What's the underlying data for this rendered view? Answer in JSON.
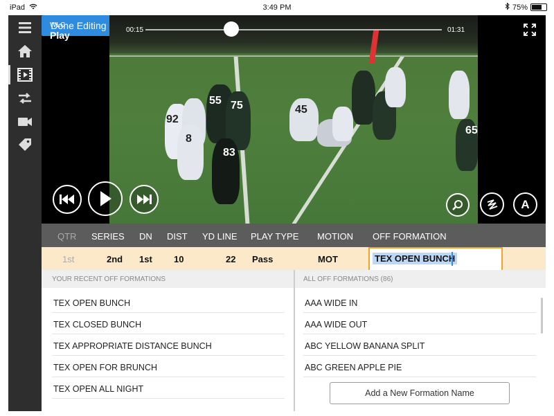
{
  "status_bar": {
    "device": "iPad",
    "time": "3:49 PM",
    "battery": "75%",
    "battery_level": 0.75
  },
  "sidebar": {
    "items": [
      {
        "icon": "menu-icon"
      },
      {
        "icon": "home-icon"
      },
      {
        "icon": "film-icon",
        "active": true
      },
      {
        "icon": "swap-icon"
      },
      {
        "icon": "video-camera-icon"
      },
      {
        "icon": "tag-icon"
      }
    ]
  },
  "video": {
    "team": "WLC",
    "title": "Play",
    "elapsed": "00:15",
    "duration": "01:31",
    "progress": 0.29,
    "done_button": "Done Editing",
    "annotate_label": "A",
    "jersey_numbers": [
      "55",
      "75",
      "92",
      "8",
      "83",
      "45",
      "65"
    ]
  },
  "table": {
    "headers": [
      "QTR",
      "SERIES",
      "DN",
      "DIST",
      "YD LINE",
      "PLAY TYPE",
      "MOTION",
      "OFF FORMATION"
    ],
    "row": [
      "1st",
      "2nd",
      "1st",
      "10",
      "22",
      "Pass",
      "MOT"
    ],
    "formation_value": "TEX OPEN BUNCH"
  },
  "recent_formations": {
    "header": "YOUR RECENT OFF FORMATIONS",
    "items": [
      "TEX OPEN BUNCH",
      "TEX CLOSED BUNCH",
      "TEX APPROPRIATE DISTANCE BUNCH",
      "TEX OPEN FOR BRUNCH",
      "TEX OPEN ALL NIGHT"
    ]
  },
  "all_formations": {
    "header": "ALL OFF FORMATIONS (86)",
    "items": [
      "AAA WIDE IN",
      "AAA WIDE OUT",
      "ABC YELLOW BANANA SPLIT",
      "ABC GREEN APPLE PIE"
    ],
    "add_button": "Add a New Formation Name"
  },
  "colors": {
    "accent": "#2f8be0",
    "highlight_row": "#fbe9c9",
    "input_border": "#f0a22a",
    "header_bg": "#5c5c5c",
    "sidebar_bg": "#2e2e2e"
  }
}
